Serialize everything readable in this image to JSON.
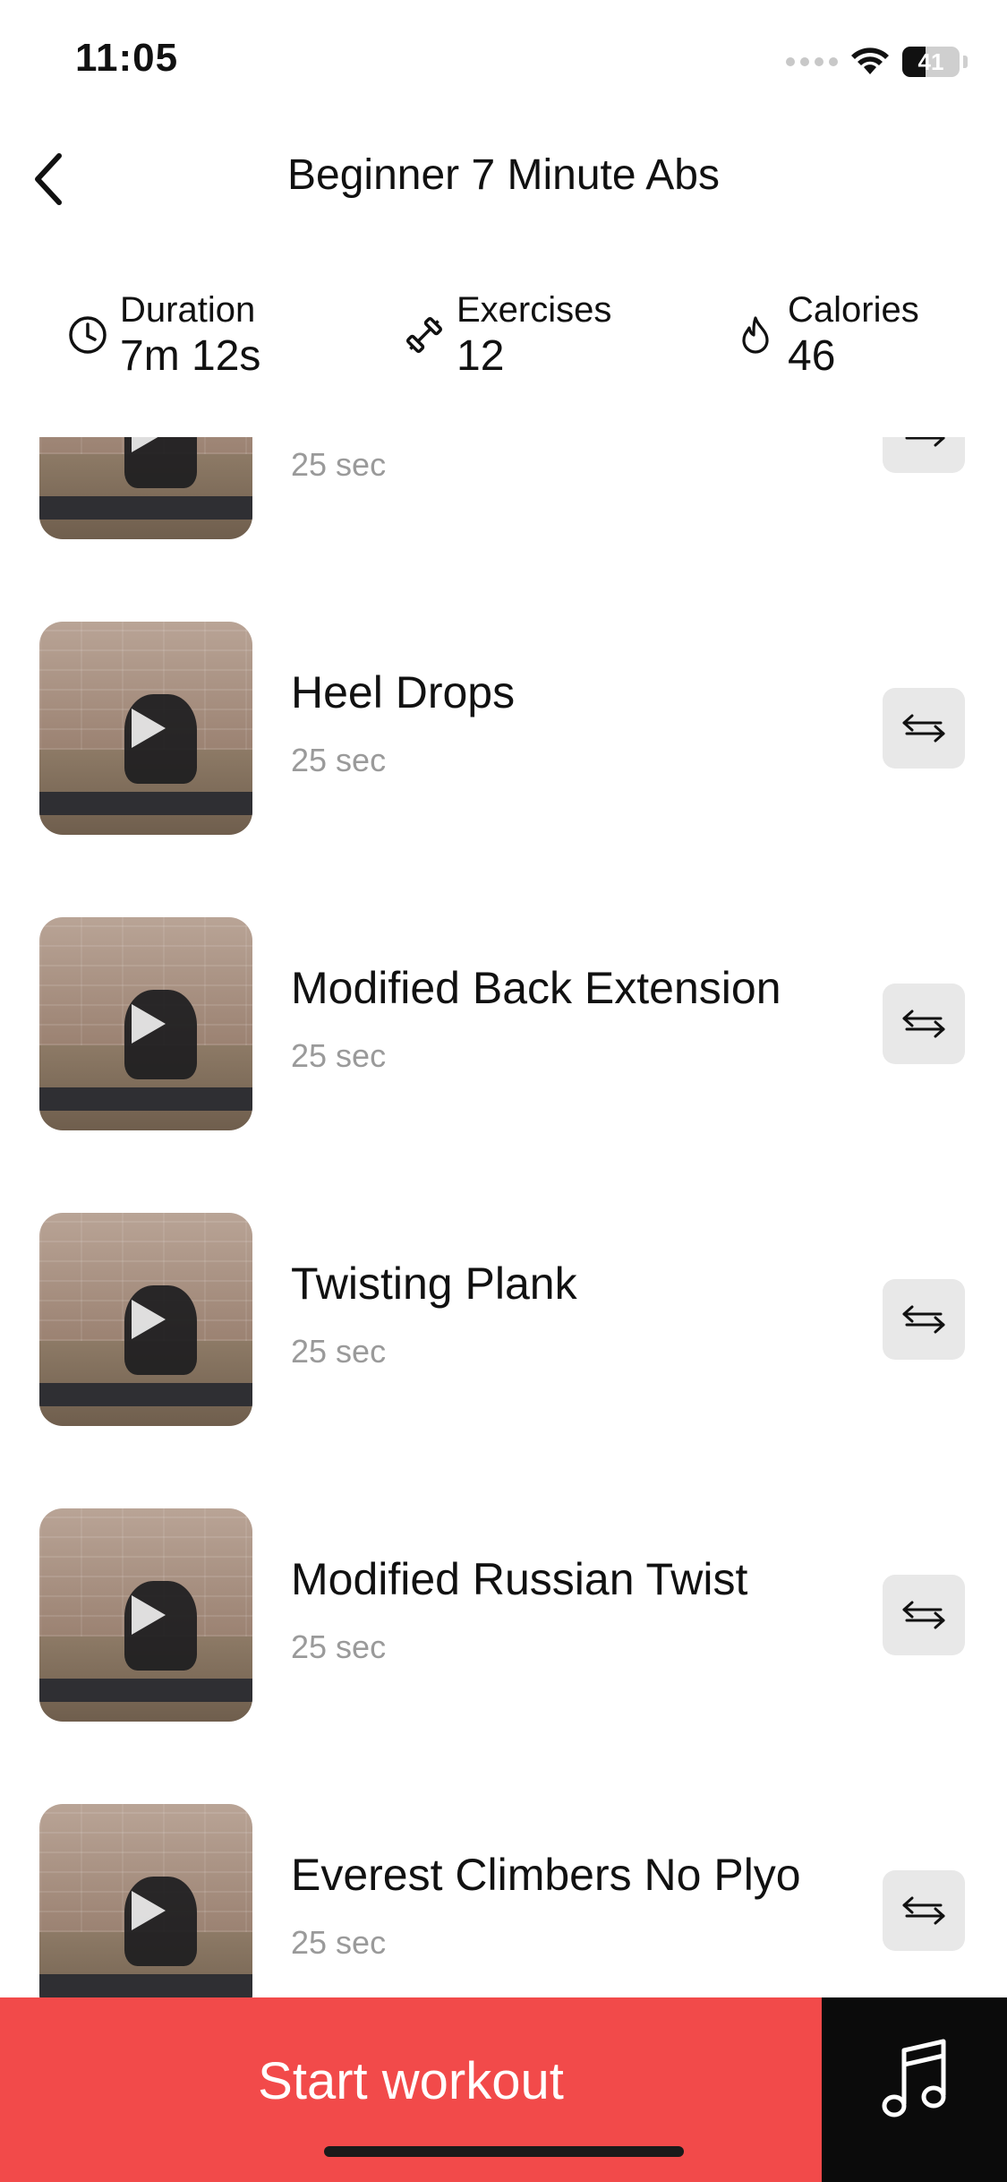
{
  "status_bar": {
    "time": "11:05",
    "battery": "41",
    "battery_level": 0.41
  },
  "nav": {
    "title": "Beginner 7 Minute Abs"
  },
  "stats": {
    "duration": {
      "label": "Duration",
      "value": "7m 12s"
    },
    "exercises": {
      "label": "Exercises",
      "value": "12"
    },
    "calories": {
      "label": "Calories",
      "value": "46"
    }
  },
  "exercises": [
    {
      "name": "",
      "duration": "25 sec"
    },
    {
      "name": "Heel Drops",
      "duration": "25 sec"
    },
    {
      "name": "Modified Back Extension",
      "duration": "25 sec"
    },
    {
      "name": "Twisting Plank",
      "duration": "25 sec"
    },
    {
      "name": "Modified Russian Twist",
      "duration": "25 sec"
    },
    {
      "name": "Everest Climbers No Plyo",
      "duration": "25 sec"
    }
  ],
  "footer": {
    "start_label": "Start workout"
  },
  "icons": [
    "chevron-left-icon",
    "clock-icon",
    "dumbbell-icon",
    "flame-icon",
    "play-icon",
    "swap-arrows-icon",
    "music-note-icon",
    "wifi-icon",
    "battery-icon"
  ],
  "colors": {
    "accent": "#f24a4a",
    "music_bg": "#0b0b0b",
    "swap_bg": "#e8e8e8",
    "secondary_text": "#9a9a9a"
  }
}
